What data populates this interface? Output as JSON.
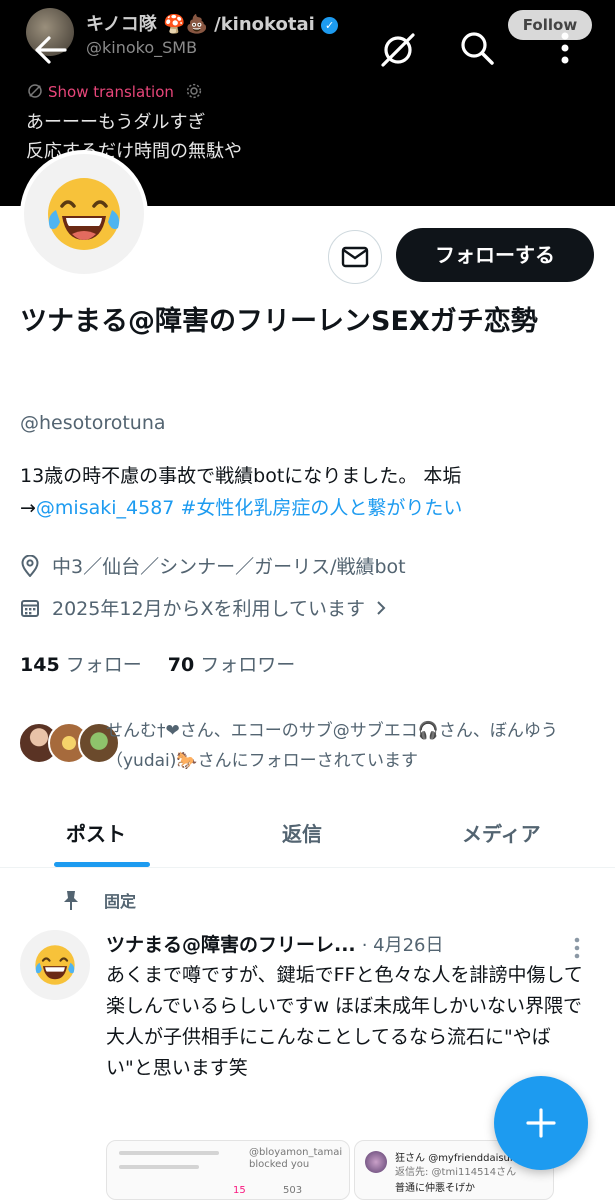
{
  "header": {
    "author_name": "キノコ隊",
    "author_name_suffix": "/kinokotai",
    "author_handle": "@kinoko_SMB",
    "follow_label": "Follow",
    "show_translation_label": "Show translation",
    "tweet_lines": [
      "あーーーもうダルすぎ",
      "反応するだけ時間の無駄や"
    ]
  },
  "profile": {
    "display_name": "ツナまる@障害のフリーレンSEXガチ恋勢",
    "handle": "@hesotorotuna",
    "follow_button": "フォローする",
    "bio_text": "13歳の時不慮の事故で戦績botになりました。 本垢→",
    "bio_mention": "@misaki_4587",
    "bio_hashtag": "#女性化乳房症の人と繋がりたい",
    "location": "中3／仙台／シンナー／ガーリス/戦績bot",
    "joined": "2025年12月からXを利用しています",
    "following_count": "145",
    "following_label": "フォロー",
    "followers_count": "70",
    "followers_label": "フォロワー",
    "followed_by_text": "せんむ†❤さん、エコーのサブ@サブエコ🎧さん、ぼんゆう（yudai)🐎さんにフォローされています"
  },
  "tabs": [
    {
      "label": "ポスト",
      "active": true
    },
    {
      "label": "返信",
      "active": false
    },
    {
      "label": "メディア",
      "active": false
    }
  ],
  "pinned_post": {
    "pinned_label": "固定",
    "author": "ツナまる@障害のフリーレ...",
    "date": "· 4月26日",
    "body": "あくまで噂ですが、鍵垢でFFと色々な人を誹謗中傷して楽しんでいるらしいですw ほぼ未成年しかいない界隈で大人が子供相手にこんなことしてるなら流石に\"やばい\"と思います笑",
    "thumb1_labels": [
      "@bloyamon_tamai",
      "blocked you",
      "503",
      "15"
    ],
    "thumb2_name": "狂さん",
    "thumb2_handle": "@myfrienddaisuk",
    "thumb2_reply": "返信先: @tmi114514さん",
    "thumb2_text": "普通に仲悪そげか"
  },
  "colors": {
    "accent": "#1d9bf0",
    "text_primary": "#0f1419",
    "text_secondary": "#536471",
    "translation": "#e8467a"
  },
  "icons": [
    "back-arrow-icon",
    "slash-circle-icon",
    "search-icon",
    "more-vertical-icon",
    "translation-icon",
    "gear-icon",
    "mail-icon",
    "location-pin-icon",
    "calendar-icon",
    "chevron-right-icon",
    "pin-icon",
    "plus-icon",
    "verified-badge-icon"
  ]
}
